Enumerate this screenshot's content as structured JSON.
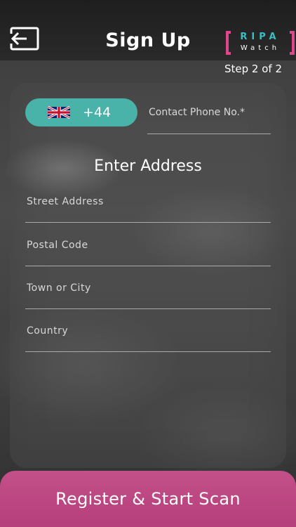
{
  "header": {
    "title": "Sign Up",
    "back_icon": "back-arrow-icon",
    "logo": {
      "top": "RIPA",
      "bottom": "Watch",
      "bracket_color": "#e0478b",
      "top_color": "#39c0c4"
    }
  },
  "step_text": "Step 2 of 2",
  "phone": {
    "country_flag": "uk-flag-icon",
    "dial_code": "+44",
    "placeholder": "Contact Phone No.*",
    "pill_color": "#49b3a9"
  },
  "address": {
    "title": "Enter Address",
    "street_placeholder": "Street Address",
    "postal_placeholder": "Postal Code",
    "town_placeholder": "Town or City",
    "country_placeholder": "Country"
  },
  "register_button": {
    "label": "Register & Start Scan",
    "color": "#c4508a"
  }
}
